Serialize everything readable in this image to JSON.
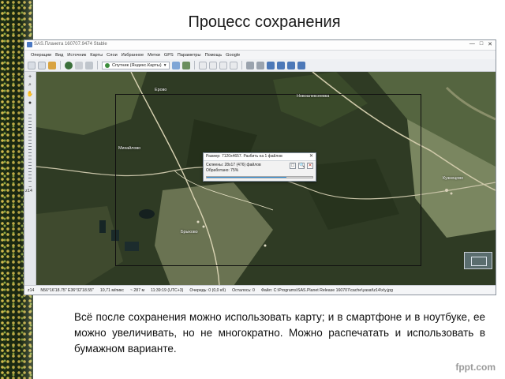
{
  "slide": {
    "title": "Процесс сохранения",
    "body": "Всё после сохранения можно использовать карту; и в смартфоне и в ноутбуке, ее можно увеличивать, но не многократно. Можно распечатать и использовать в бумажном варианте.",
    "watermark": "fppt.com"
  },
  "app": {
    "window_title": "SAS.Планета 160707.9474 Stable",
    "window_buttons": [
      "—",
      "□",
      "✕"
    ],
    "menu": [
      "Операции",
      "Вид",
      "Источник",
      "Карты",
      "Слои",
      "Избранное",
      "Метки",
      "GPS",
      "Параметры",
      "Помощь",
      "Google"
    ],
    "map_source": "Спутник (Яндекс.Карты)",
    "zoom_level": "z14",
    "status": [
      "z14",
      "N56°16'18.75\" E36°32'18.55\"",
      "10,71 м/пикс",
      "~ 287 м",
      "11:39:19 (UTC+3)",
      "Очередь: 0 (0,0 кб)",
      "Осталось: 0",
      "Файл: C:\\Programs\\SAS.Planet Release 160707\\cache\\yasat\\z14\\x\\y.jpg"
    ]
  },
  "dialog": {
    "title": "Размер: 7120x4657. Разбить на 1 файлов",
    "line1": "Склеены: 28x17 (476) файлов",
    "line2": "Обработано: 75%",
    "progress_percent": 75,
    "buttons": [
      "□",
      "🔍",
      "✕"
    ]
  },
  "map_labels": [
    "Ерово",
    "Михайлово",
    "Брыково",
    "Новоалексеевка",
    "Кузнецово"
  ],
  "colors": {
    "map_forest": "#2f3b24",
    "progress_blue": "#2f8fd8",
    "deco_strip": "#1d2d14",
    "deco_dots": "#f3d75a"
  }
}
